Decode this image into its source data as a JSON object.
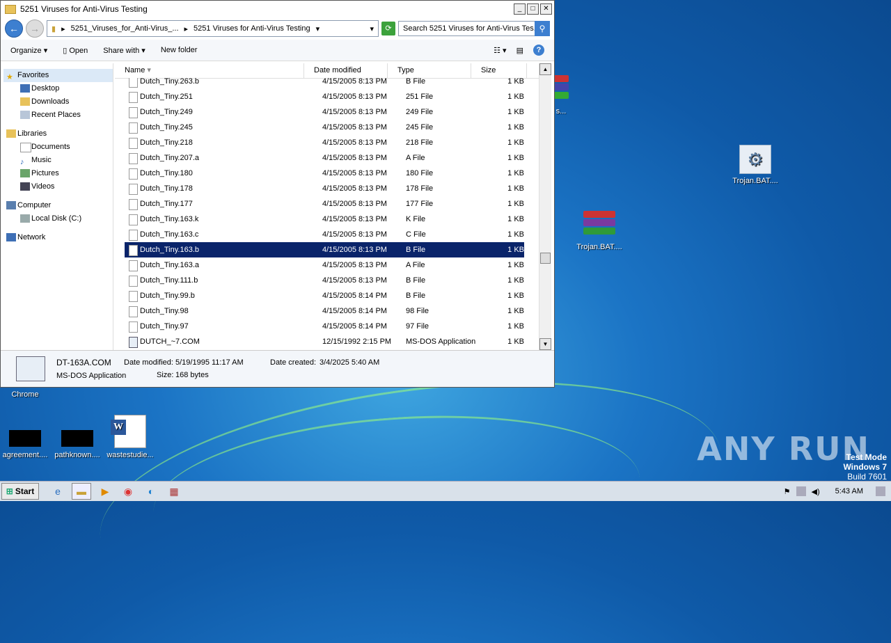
{
  "window": {
    "title": "5251 Viruses for Anti-Virus Testing",
    "breadcrumb": [
      "5251_Viruses_for_Anti-Virus_...",
      "5251 Viruses for Anti-Virus Testing"
    ],
    "search_placeholder": "Search 5251 Viruses for Anti-Virus Tes...",
    "toolbar": {
      "organize": "Organize",
      "open": "Open",
      "share_with": "Share with",
      "new_folder": "New folder"
    },
    "columns": {
      "name": "Name",
      "date": "Date modified",
      "type": "Type",
      "size": "Size"
    },
    "nav": {
      "favorites": "Favorites",
      "desktop": "Desktop",
      "downloads": "Downloads",
      "recent": "Recent Places",
      "libraries": "Libraries",
      "documents": "Documents",
      "music": "Music",
      "pictures": "Pictures",
      "videos": "Videos",
      "computer": "Computer",
      "local_disk": "Local Disk (C:)",
      "network": "Network"
    },
    "files": [
      {
        "name": "Dutch_Tiny.263.b",
        "date": "4/15/2005 8:13 PM",
        "type": "B File",
        "size": "1 KB"
      },
      {
        "name": "Dutch_Tiny.251",
        "date": "4/15/2005 8:13 PM",
        "type": "251 File",
        "size": "1 KB"
      },
      {
        "name": "Dutch_Tiny.249",
        "date": "4/15/2005 8:13 PM",
        "type": "249 File",
        "size": "1 KB"
      },
      {
        "name": "Dutch_Tiny.245",
        "date": "4/15/2005 8:13 PM",
        "type": "245 File",
        "size": "1 KB"
      },
      {
        "name": "Dutch_Tiny.218",
        "date": "4/15/2005 8:13 PM",
        "type": "218 File",
        "size": "1 KB"
      },
      {
        "name": "Dutch_Tiny.207.a",
        "date": "4/15/2005 8:13 PM",
        "type": "A File",
        "size": "1 KB"
      },
      {
        "name": "Dutch_Tiny.180",
        "date": "4/15/2005 8:13 PM",
        "type": "180 File",
        "size": "1 KB"
      },
      {
        "name": "Dutch_Tiny.178",
        "date": "4/15/2005 8:13 PM",
        "type": "178 File",
        "size": "1 KB"
      },
      {
        "name": "Dutch_Tiny.177",
        "date": "4/15/2005 8:13 PM",
        "type": "177 File",
        "size": "1 KB"
      },
      {
        "name": "Dutch_Tiny.163.k",
        "date": "4/15/2005 8:13 PM",
        "type": "K File",
        "size": "1 KB"
      },
      {
        "name": "Dutch_Tiny.163.c",
        "date": "4/15/2005 8:13 PM",
        "type": "C File",
        "size": "1 KB"
      },
      {
        "name": "Dutch_Tiny.163.b",
        "date": "4/15/2005 8:13 PM",
        "type": "B File",
        "size": "1 KB"
      },
      {
        "name": "Dutch_Tiny.163.a",
        "date": "4/15/2005 8:13 PM",
        "type": "A File",
        "size": "1 KB"
      },
      {
        "name": "Dutch_Tiny.111.b",
        "date": "4/15/2005 8:13 PM",
        "type": "B File",
        "size": "1 KB"
      },
      {
        "name": "Dutch_Tiny.99.b",
        "date": "4/15/2005 8:14 PM",
        "type": "B File",
        "size": "1 KB"
      },
      {
        "name": "Dutch_Tiny.98",
        "date": "4/15/2005 8:14 PM",
        "type": "98 File",
        "size": "1 KB"
      },
      {
        "name": "Dutch_Tiny.97",
        "date": "4/15/2005 8:14 PM",
        "type": "97 File",
        "size": "1 KB"
      },
      {
        "name": "DUTCH_~7.COM",
        "date": "12/15/1992 2:15 PM",
        "type": "MS-DOS Application",
        "size": "1 KB"
      }
    ],
    "selected_index": 11,
    "details": {
      "filename": "DT-163A.COM",
      "kind": "MS-DOS Application",
      "modified_label": "Date modified:",
      "modified": "5/19/1995 11:17 AM",
      "created_label": "Date created:",
      "created": "3/4/2025 5:40 AM",
      "size_label": "Size:",
      "size": "168 bytes"
    }
  },
  "desktop": {
    "icons": {
      "partial_top": "s...",
      "trojan_gear": "Trojan.BAT....",
      "trojan_rar": "Trojan.BAT....",
      "chrome": "Chrome",
      "agreement": "agreement....",
      "pathknown": "pathknown....",
      "wastestudie": "wastestudie..."
    },
    "watermark": "ANY RUN",
    "testmode": {
      "line1": "Test Mode",
      "line2": "Windows 7",
      "line3": "Build 7601"
    }
  },
  "taskbar": {
    "start": "Start",
    "clock": "5:43 AM"
  },
  "colors": {
    "selection": "#0a246a",
    "desktop": "#1b74c5"
  }
}
